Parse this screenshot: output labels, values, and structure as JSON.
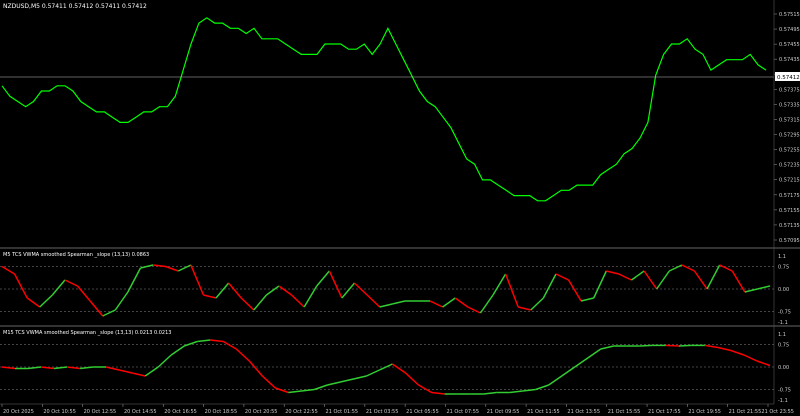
{
  "window": {
    "title": "NZDUSD,M5  0.57411 0.57412 0.57411 0.57412"
  },
  "main_panel": {
    "price_ticks": [
      "0.57515",
      "0.57495",
      "0.57455",
      "0.57435",
      "0.57395",
      "0.57375",
      "0.57335",
      "0.57315",
      "0.57295",
      "0.57255",
      "0.57235",
      "0.57215",
      "0.57175",
      "0.57155",
      "0.57135",
      "0.57095"
    ],
    "current_price": "0.57412",
    "candle_color": "#00ff00",
    "price_line_color": "#c0c0c0"
  },
  "indicator_1": {
    "title": "M5 TCS VWMA smoothed Spearman _slope (13,13) 0.0863",
    "levels": [
      "1.1",
      "0.75",
      "0.00",
      "-0.75",
      "-1.1"
    ],
    "up_color": "#32cd32",
    "down_color": "#ff0000"
  },
  "indicator_2": {
    "title": "M15 TCS VWMA smoothed Spearman _slope (13,13) 0.0213 0.0213",
    "levels": [
      "1.1",
      "0.75",
      "0.00",
      "-0.75",
      "-1.1"
    ],
    "up_color": "#32cd32",
    "down_color": "#ff0000"
  },
  "time_axis": {
    "labels": [
      "20 Oct 2025",
      "20 Oct 10:55",
      "20 Oct 12:55",
      "20 Oct 14:55",
      "20 Oct 16:55",
      "20 Oct 18:55",
      "20 Oct 20:55",
      "20 Oct 22:55",
      "21 Oct 01:55",
      "21 Oct 03:55",
      "21 Oct 05:55",
      "21 Oct 07:55",
      "21 Oct 09:55",
      "21 Oct 11:55",
      "21 Oct 13:55",
      "21 Oct 15:55",
      "21 Oct 17:55",
      "21 Oct 19:55",
      "21 Oct 21:55",
      "21 Oct 23:55"
    ]
  },
  "chart_data": [
    {
      "type": "line",
      "title": "NZDUSD,M5  0.57411 0.57412 0.57411 0.57412",
      "series": [
        {
          "values": [
            0.5738,
            0.5736,
            0.5735,
            0.5734,
            0.5735,
            0.5737,
            0.5737,
            0.5738,
            0.5738,
            0.5737,
            0.5735,
            0.5734,
            0.5733,
            0.5733,
            0.5732,
            0.5731,
            0.5731,
            0.5732,
            0.5733,
            0.5733,
            0.5734,
            0.5734,
            0.5736,
            0.5741,
            0.5746,
            0.575,
            0.5751,
            0.575,
            0.575,
            0.5749,
            0.5749,
            0.5748,
            0.5749,
            0.5747,
            0.5747,
            0.5747,
            0.5746,
            0.5745,
            0.5744,
            0.5744,
            0.5744,
            0.5746,
            0.5746,
            0.5746,
            0.5745,
            0.5745,
            0.5746,
            0.5744,
            0.5746,
            0.5749,
            0.5746,
            0.5743,
            0.574,
            0.5737,
            0.5735,
            0.5734,
            0.5732,
            0.573,
            0.5727,
            0.5724,
            0.5723,
            0.572,
            0.572,
            0.5719,
            0.5718,
            0.5717,
            0.5717,
            0.5717,
            0.5716,
            0.5716,
            0.5717,
            0.5718,
            0.5718,
            0.5719,
            0.5719,
            0.5719,
            0.5721,
            0.5722,
            0.5723,
            0.5725,
            0.5726,
            0.5728,
            0.5731,
            0.574,
            0.5744,
            0.5746,
            0.5746,
            0.5747,
            0.5745,
            0.5744,
            0.5741,
            0.5742,
            0.5743,
            0.5743,
            0.5743,
            0.5744,
            0.5742,
            0.5741
          ]
        }
      ],
      "ylim": [
        0.57085,
        0.57525
      ]
    },
    {
      "type": "line",
      "title": "M5 TCS VWMA smoothed Spearman _slope (13,13) 0.0863",
      "series": [
        {
          "values": [
            0.75,
            0.5,
            -0.3,
            -0.6,
            -0.2,
            0.3,
            0.1,
            -0.4,
            -0.9,
            -0.7,
            -0.1,
            0.7,
            0.8,
            0.75,
            0.6,
            0.8,
            -0.2,
            -0.3,
            0.2,
            -0.3,
            -0.7,
            -0.2,
            0.1,
            -0.2,
            -0.6,
            0.1,
            0.6,
            -0.3,
            0.2,
            -0.2,
            -0.6,
            -0.5,
            -0.4,
            -0.4,
            -0.4,
            -0.6,
            -0.3,
            -0.6,
            -0.8,
            -0.2,
            0.5,
            -0.6,
            -0.7,
            -0.3,
            0.5,
            0.3,
            -0.4,
            -0.3,
            0.6,
            0.5,
            0.3,
            0.6,
            0.0,
            0.6,
            0.8,
            0.6,
            0.0,
            0.8,
            0.6,
            -0.1,
            0.0,
            0.1
          ]
        }
      ],
      "ylim": [
        -1.1,
        1.1
      ]
    },
    {
      "type": "line",
      "title": "M15 TCS VWMA smoothed Spearman _slope (13,13) 0.0213 0.0213",
      "series": [
        {
          "values": [
            0.0,
            -0.05,
            -0.05,
            0.0,
            -0.05,
            0.0,
            -0.05,
            0.0,
            0.0,
            -0.1,
            -0.2,
            -0.3,
            0.0,
            0.4,
            0.7,
            0.85,
            0.9,
            0.85,
            0.6,
            0.2,
            -0.3,
            -0.7,
            -0.85,
            -0.8,
            -0.75,
            -0.6,
            -0.5,
            -0.4,
            -0.3,
            -0.1,
            0.1,
            -0.2,
            -0.6,
            -0.85,
            -0.9,
            -0.9,
            -0.9,
            -0.9,
            -0.85,
            -0.85,
            -0.8,
            -0.75,
            -0.6,
            -0.3,
            0.0,
            0.3,
            0.6,
            0.7,
            0.7,
            0.7,
            0.72,
            0.72,
            0.7,
            0.72,
            0.72,
            0.65,
            0.55,
            0.4,
            0.2,
            0.05
          ]
        }
      ],
      "ylim": [
        -1.1,
        1.1
      ]
    }
  ]
}
